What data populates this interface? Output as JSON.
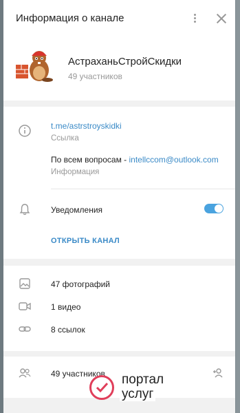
{
  "header": {
    "title": "Информация о канале",
    "channel_name": "АстраханьСтройСкидки",
    "subscribers": "49 участников"
  },
  "info": {
    "link": "t.me/astrstroyskidki",
    "link_label": "Ссылка",
    "contact_prefix": "По всем вопросам - ",
    "contact_email": "intellccom@outlook.com",
    "contact_label": "Информация",
    "notifications_label": "Уведомления",
    "notifications_on": true,
    "open_channel": "ОТКРЫТЬ КАНАЛ"
  },
  "media": {
    "photos": "47 фотографий",
    "videos": "1 видео",
    "links": "8 ссылок"
  },
  "members": {
    "count": "49 участников"
  },
  "watermark": {
    "line1": "портал",
    "line2": "услуг"
  },
  "colors": {
    "accent": "#3a8ac7",
    "toggle": "#4aa3df",
    "watermark_brand": "#e03e5a"
  }
}
